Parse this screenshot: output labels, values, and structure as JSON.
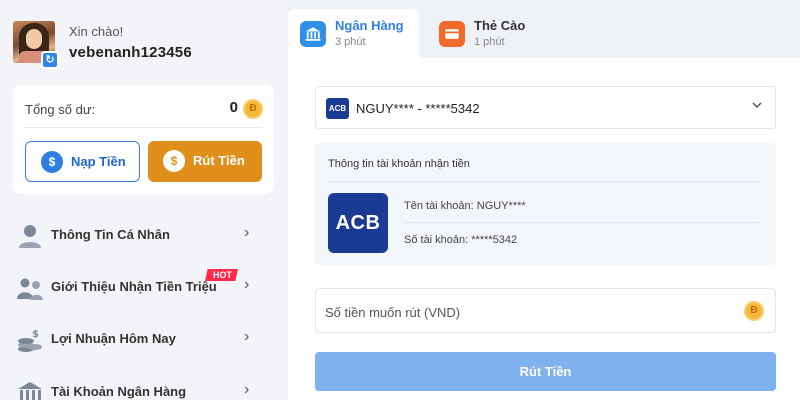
{
  "user": {
    "greeting": "Xin chào!",
    "username": "vebenanh123456"
  },
  "balance": {
    "label": "Tổng số dư:",
    "value": "0",
    "currency_icon": "dong-coin-icon",
    "currency_symbol": "Đ"
  },
  "actions": {
    "deposit_label": "Nạp Tiền",
    "withdraw_label": "Rút Tiền",
    "deposit_icon": "$",
    "withdraw_icon": "$"
  },
  "menu": {
    "items": [
      {
        "label": "Thông Tin Cá Nhân",
        "icon": "user-icon"
      },
      {
        "label": "Giới Thiệu Nhận Tiền Triệu",
        "icon": "referral-icon",
        "badge": "HOT"
      },
      {
        "label": "Lợi Nhuận Hôm Nay",
        "icon": "coins-stack-icon"
      },
      {
        "label": "Tài Khoản Ngân Hàng",
        "icon": "bank-icon"
      }
    ],
    "chevron": "›"
  },
  "tabs": [
    {
      "title": "Ngân Hàng",
      "sub": "3 phút",
      "icon": "bank-icon",
      "active": true
    },
    {
      "title": "Thẻ Cào",
      "sub": "1 phút",
      "icon": "card-icon",
      "active": false
    }
  ],
  "bank_select": {
    "logo": "ACB",
    "value": "NGUY**** - *****5342"
  },
  "account_info": {
    "title": "Thông tin tài khoản nhận tiền",
    "logo": "ACB",
    "name_line": "Tên tài khoản: NGUY****",
    "number_line": "Số tài khoản: *****5342"
  },
  "amount": {
    "placeholder": "Số tiền muốn rút (VND)"
  },
  "submit_label": "Rút Tiền",
  "colors": {
    "accent_blue": "#2f7fe0",
    "withdraw_orange": "#e0901a",
    "submit_disabled": "#7fb1ee",
    "acb_navy": "#1b3a94",
    "hot_red": "#ff2a4a"
  }
}
